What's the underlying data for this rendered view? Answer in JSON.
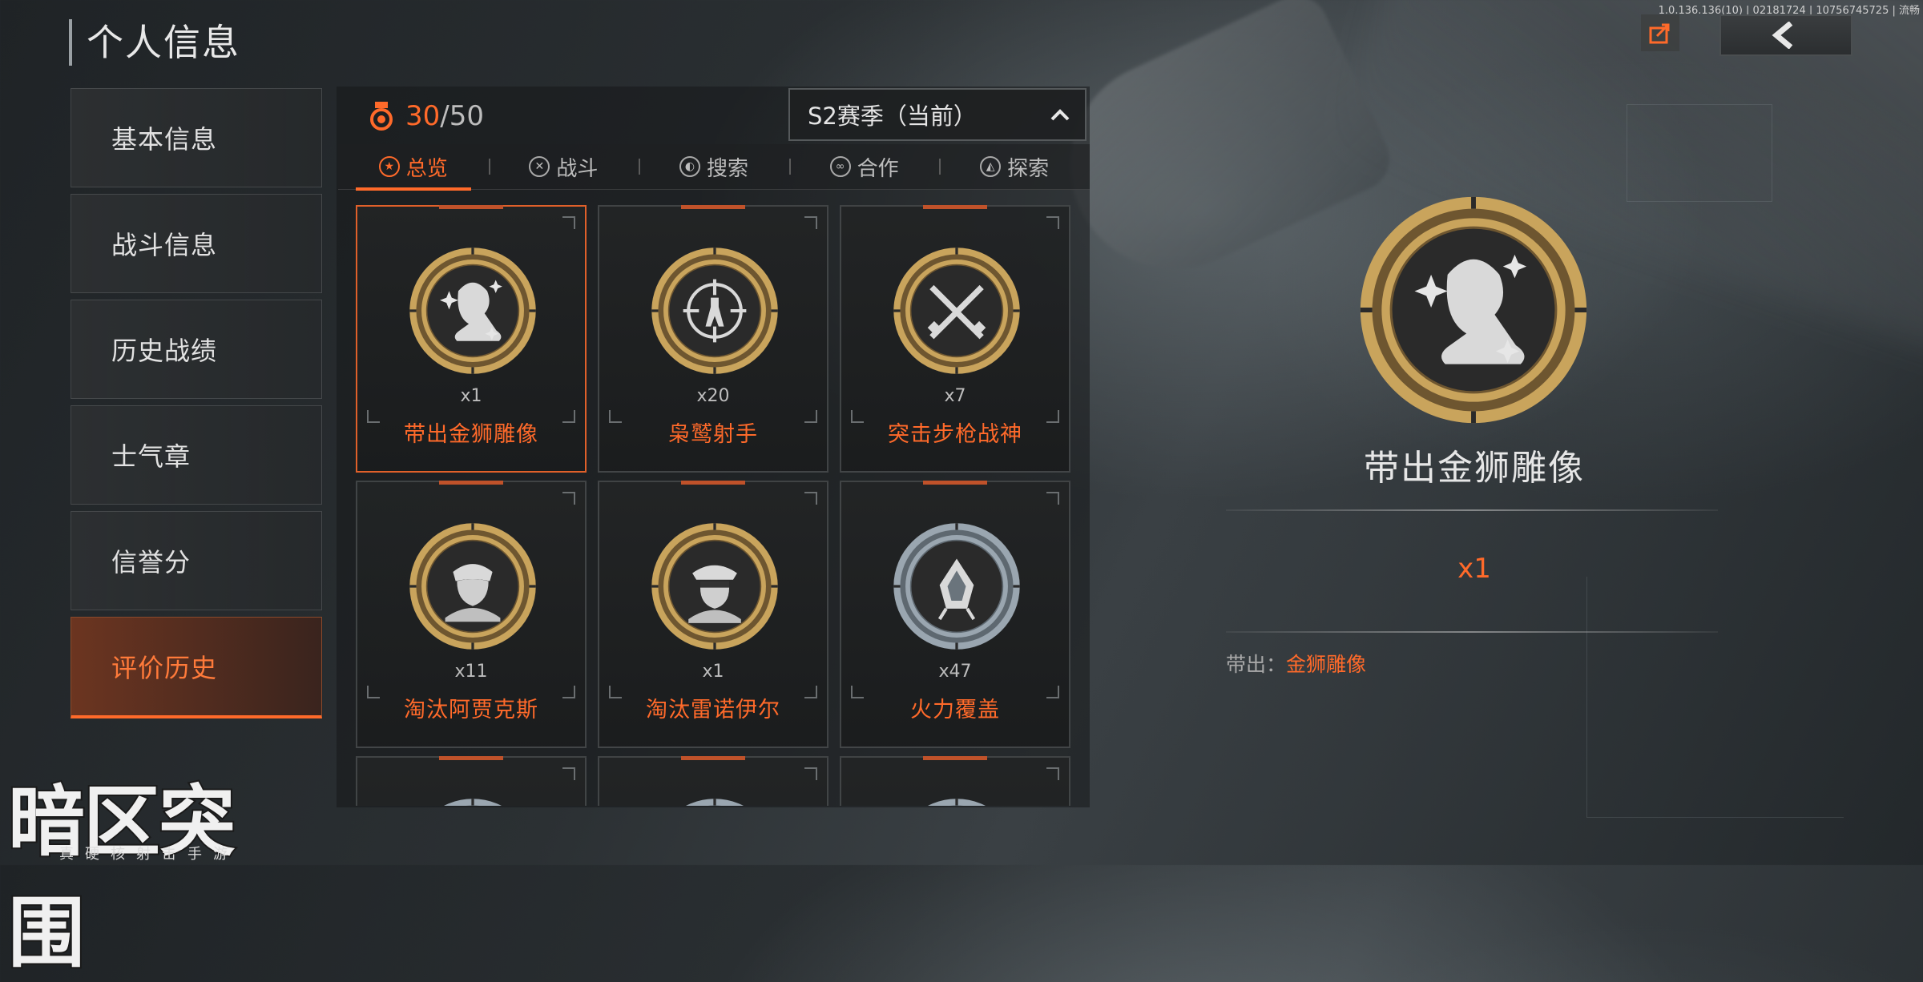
{
  "page_title": "个人信息",
  "top_info": "1.0.136.136(10) | 02181724 | 10756745725 | 流畅",
  "sidebar": {
    "items": [
      {
        "label": "基本信息"
      },
      {
        "label": "战斗信息"
      },
      {
        "label": "历史战绩"
      },
      {
        "label": "士气章"
      },
      {
        "label": "信誉分"
      },
      {
        "label": "评价历史"
      }
    ],
    "active_index": 5
  },
  "progress": {
    "current": "30",
    "total": "/50"
  },
  "season": {
    "label": "S2赛季（当前）"
  },
  "tabs": [
    {
      "label": "总览",
      "icon": "star-icon"
    },
    {
      "label": "战斗",
      "icon": "crossed-guns-icon"
    },
    {
      "label": "搜索",
      "icon": "radar-icon"
    },
    {
      "label": "合作",
      "icon": "handshake-icon"
    },
    {
      "label": "探索",
      "icon": "compass-icon"
    }
  ],
  "achievements": [
    {
      "count": "x1",
      "name": "带出金狮雕像",
      "icon": "lion-icon",
      "ring": "gold",
      "selected": true
    },
    {
      "count": "x20",
      "name": "枭鹫射手",
      "icon": "crosshair-soldier-icon",
      "ring": "gold"
    },
    {
      "count": "x7",
      "name": "突击步枪战神",
      "icon": "crossed-rifles-icon",
      "ring": "gold"
    },
    {
      "count": "x11",
      "name": "淘汰阿贾克斯",
      "icon": "soldier-portrait-icon",
      "ring": "gold"
    },
    {
      "count": "x1",
      "name": "淘汰雷诺伊尔",
      "icon": "officer-portrait-icon",
      "ring": "gold"
    },
    {
      "count": "x47",
      "name": "火力覆盖",
      "icon": "rocket-icon",
      "ring": "silver"
    },
    {
      "count": "",
      "name": "",
      "icon": "medal-icon",
      "ring": "silver"
    },
    {
      "count": "",
      "name": "",
      "icon": "medal-icon",
      "ring": "silver"
    },
    {
      "count": "",
      "name": "",
      "icon": "medal-icon",
      "ring": "silver"
    }
  ],
  "detail": {
    "name": "带出金狮雕像",
    "count": "x1",
    "source_label": "带出：",
    "source_value": "金狮雕像"
  },
  "logo": {
    "title": "暗区突围",
    "subtitle": "真硬核射击手游"
  },
  "colors": {
    "accent": "#ff6a2a",
    "gold": "#c9a45c",
    "silver": "#9aa6b0"
  }
}
